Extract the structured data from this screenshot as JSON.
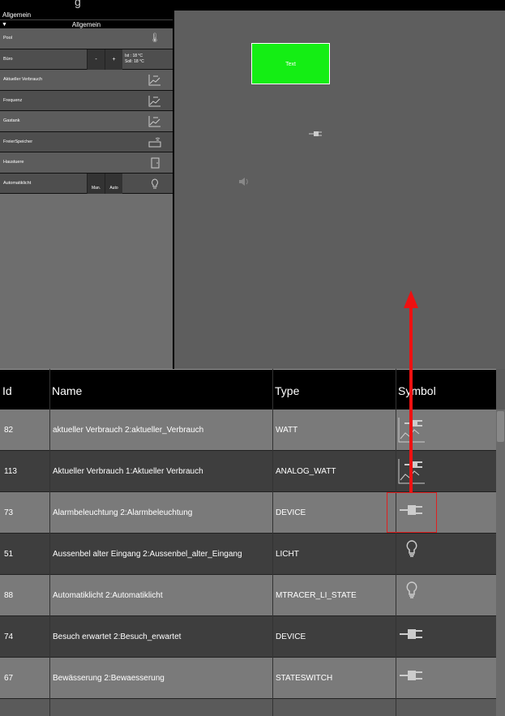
{
  "topbar": {
    "title": "g"
  },
  "left_panel": {
    "header": "Allgemein",
    "subheader": "Allgemein",
    "items": [
      {
        "label": "Pool",
        "icon": "thermometer-icon"
      },
      {
        "label": "Büro",
        "btn_minus": "-",
        "btn_plus": "+",
        "ist": "Ist : 18 °C",
        "soll": "Soll: 18 °C"
      },
      {
        "label": "Aktueller Verbrauch",
        "icon": "chart-icon"
      },
      {
        "label": "Frequenz",
        "icon": "chart-icon"
      },
      {
        "label": "Gastank",
        "icon": "chart-icon"
      },
      {
        "label": "FreierSpeicher",
        "icon": "device-icon"
      },
      {
        "label": "Haustuere",
        "icon": "door-icon"
      },
      {
        "label": "Automatiklicht",
        "btn_man": "Man.",
        "btn_auto": "Auto",
        "icon": "bulb-icon"
      }
    ]
  },
  "canvas": {
    "green_button": "Text"
  },
  "table": {
    "headers": [
      "Id",
      "Name",
      "Type",
      "Symbol"
    ],
    "rows": [
      {
        "id": "82",
        "name": "aktueller Verbrauch  2:aktueller_Verbrauch",
        "type": "WATT",
        "symbol": "chart-plug-icon"
      },
      {
        "id": "113",
        "name": "Aktueller Verbrauch  1:Aktueller Verbrauch",
        "type": "ANALOG_WATT",
        "symbol": "chart-plug-icon"
      },
      {
        "id": "73",
        "name": "Alarmbeleuchtung  2:Alarmbeleuchtung",
        "type": "DEVICE",
        "symbol": "plug-icon"
      },
      {
        "id": "51",
        "name": "Aussenbel alter Eingang  2:Aussenbel_alter_Eingang",
        "type": "LICHT",
        "symbol": "bulb-icon"
      },
      {
        "id": "88",
        "name": "Automatiklicht  2:Automatiklicht",
        "type": "MTRACER_LI_STATE",
        "symbol": "bulb-icon"
      },
      {
        "id": "74",
        "name": "Besuch erwartet  2:Besuch_erwartet",
        "type": "DEVICE",
        "symbol": "plug-icon"
      },
      {
        "id": "67",
        "name": "Bewässerung  2:Bewaesserung",
        "type": "STATESWITCH",
        "symbol": "plug-icon"
      }
    ]
  },
  "colors": {
    "highlight": "#e02020",
    "green": "#14ee14"
  }
}
